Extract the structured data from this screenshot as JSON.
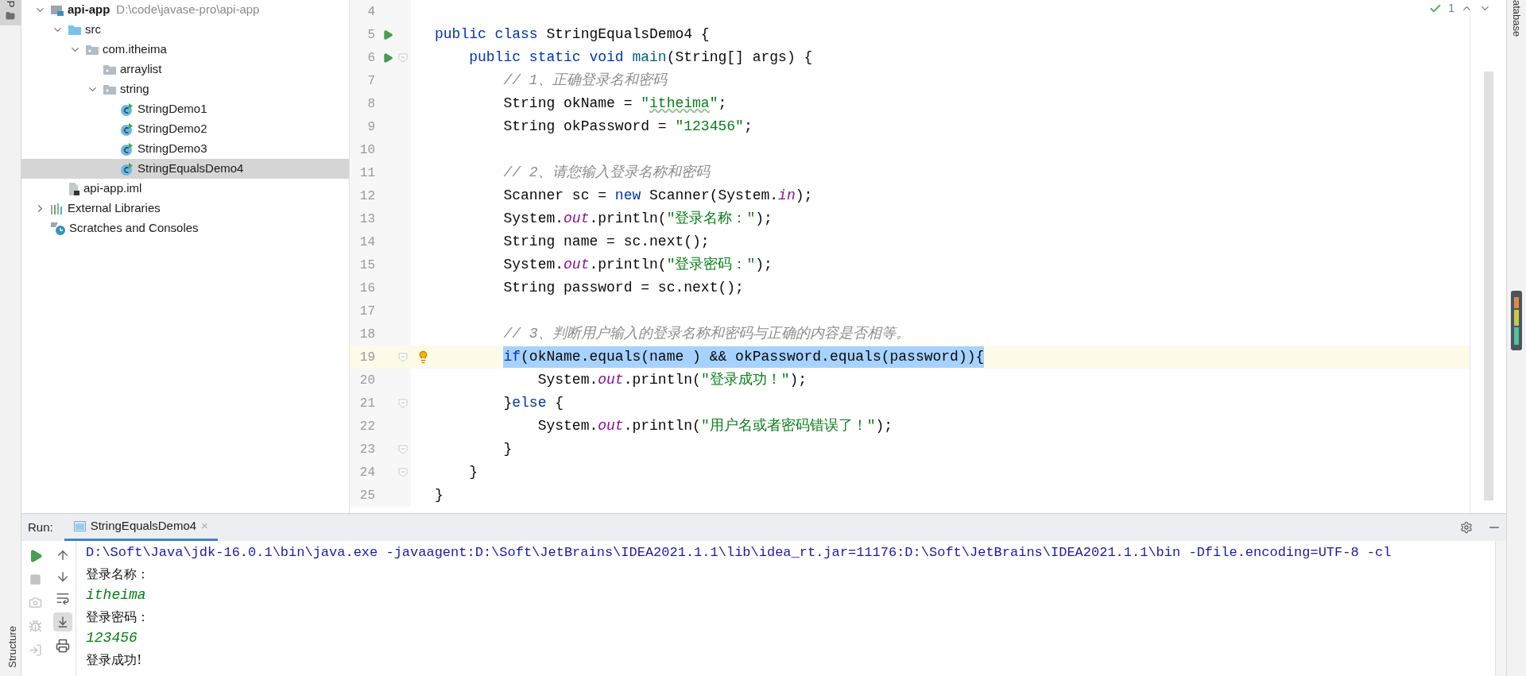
{
  "left_strip": {
    "top_tab": {
      "label": "P",
      "selected": true
    },
    "bottom_tab": {
      "label": "Structure"
    }
  },
  "right_strip": {
    "label": "atabase"
  },
  "project_tree": [
    {
      "label": "api-app",
      "path": "D:\\code\\javase-pro\\api-app",
      "kind": "module",
      "expanded": true,
      "selected": false,
      "children": [
        {
          "label": "src",
          "kind": "source_folder",
          "expanded": true,
          "selected": false,
          "children": [
            {
              "label": "com.itheima",
              "kind": "package",
              "expanded": true,
              "selected": false,
              "children": [
                {
                  "label": "arraylist",
                  "kind": "package",
                  "selected": false
                },
                {
                  "label": "string",
                  "kind": "package",
                  "expanded": true,
                  "selected": false,
                  "children": [
                    {
                      "label": "StringDemo1",
                      "kind": "class",
                      "selected": false
                    },
                    {
                      "label": "StringDemo2",
                      "kind": "class",
                      "selected": false
                    },
                    {
                      "label": "StringDemo3",
                      "kind": "class",
                      "selected": false
                    },
                    {
                      "label": "StringEqualsDemo4",
                      "kind": "class",
                      "selected": true
                    }
                  ]
                }
              ]
            }
          ]
        },
        {
          "label": "api-app.iml",
          "kind": "iml",
          "selected": false
        }
      ]
    },
    {
      "label": "External Libraries",
      "kind": "libraries",
      "expanded": false,
      "selected": false
    },
    {
      "label": "Scratches and Consoles",
      "kind": "scratches",
      "selected": false
    }
  ],
  "editor": {
    "inspections": {
      "count": "1"
    },
    "lines": [
      {
        "number": "4"
      },
      {
        "number": "5",
        "run": true,
        "tokens": [
          {
            "kind": "kw",
            "text": "public class"
          },
          {
            "kind": "id",
            "text": " StringEqualsDemo4 {"
          }
        ]
      },
      {
        "number": "6",
        "run": true,
        "fold": true,
        "tokens": [
          {
            "kind": "kw",
            "text": "    public static void "
          },
          {
            "kind": "fn",
            "text": "main"
          },
          {
            "kind": "id",
            "text": "(String[] args) {"
          }
        ]
      },
      {
        "number": "7",
        "tokens": [
          {
            "kind": "com",
            "text": "        // 1、正确登录名和密码"
          }
        ]
      },
      {
        "number": "8",
        "tokens": [
          {
            "kind": "id",
            "text": "        String okName = "
          },
          {
            "kind": "str",
            "text": "\""
          },
          {
            "kind": "str_warn",
            "text": "itheima"
          },
          {
            "kind": "str",
            "text": "\""
          },
          {
            "kind": "id",
            "text": ";"
          }
        ]
      },
      {
        "number": "9",
        "tokens": [
          {
            "kind": "id",
            "text": "        String okPassword = "
          },
          {
            "kind": "str",
            "text": "\"123456\""
          },
          {
            "kind": "id",
            "text": ";"
          }
        ]
      },
      {
        "number": "10"
      },
      {
        "number": "11",
        "tokens": [
          {
            "kind": "com",
            "text": "        // 2、请您输入登录名称和密码"
          }
        ]
      },
      {
        "number": "12",
        "tokens": [
          {
            "kind": "id",
            "text": "        Scanner sc = "
          },
          {
            "kind": "kw",
            "text": "new"
          },
          {
            "kind": "id",
            "text": " Scanner(System."
          },
          {
            "kind": "field",
            "text": "in"
          },
          {
            "kind": "id",
            "text": ");"
          }
        ]
      },
      {
        "number": "13",
        "tokens": [
          {
            "kind": "id",
            "text": "        System."
          },
          {
            "kind": "field",
            "text": "out"
          },
          {
            "kind": "id",
            "text": ".println("
          },
          {
            "kind": "str",
            "text": "\"登录名称：\""
          },
          {
            "kind": "id",
            "text": ");"
          }
        ]
      },
      {
        "number": "14",
        "tokens": [
          {
            "kind": "id",
            "text": "        String name = sc.next();"
          }
        ]
      },
      {
        "number": "15",
        "tokens": [
          {
            "kind": "id",
            "text": "        System."
          },
          {
            "kind": "field",
            "text": "out"
          },
          {
            "kind": "id",
            "text": ".println("
          },
          {
            "kind": "str",
            "text": "\"登录密码：\""
          },
          {
            "kind": "id",
            "text": ");"
          }
        ]
      },
      {
        "number": "16",
        "tokens": [
          {
            "kind": "id",
            "text": "        String password = sc.next();"
          }
        ]
      },
      {
        "number": "17"
      },
      {
        "number": "18",
        "tokens": [
          {
            "kind": "com",
            "text": "        // 3、判断用户输入的登录名称和密码与正确的内容是否相等。"
          }
        ]
      },
      {
        "number": "19",
        "current": true,
        "highlighted": true,
        "fold": true,
        "bulb": true,
        "tokens": [
          {
            "kind": "kw",
            "text": "        if"
          },
          {
            "kind": "id",
            "text": "(okName.equals(name ) && okPassword.equals(password)){"
          }
        ]
      },
      {
        "number": "20",
        "tokens": [
          {
            "kind": "id",
            "text": "            System."
          },
          {
            "kind": "field",
            "text": "out"
          },
          {
            "kind": "id",
            "text": ".println("
          },
          {
            "kind": "str",
            "text": "\"登录成功！\""
          },
          {
            "kind": "id",
            "text": ");"
          }
        ]
      },
      {
        "number": "21",
        "fold": true,
        "tokens": [
          {
            "kind": "id",
            "text": "        }"
          },
          {
            "kind": "kw",
            "text": "else"
          },
          {
            "kind": "id",
            "text": " {"
          }
        ]
      },
      {
        "number": "22",
        "tokens": [
          {
            "kind": "id",
            "text": "            System."
          },
          {
            "kind": "field",
            "text": "out"
          },
          {
            "kind": "id",
            "text": ".println("
          },
          {
            "kind": "str",
            "text": "\"用户名或者密码错误了！\""
          },
          {
            "kind": "id",
            "text": ");"
          }
        ]
      },
      {
        "number": "23",
        "fold": true,
        "tokens": [
          {
            "kind": "id",
            "text": "        }"
          }
        ]
      },
      {
        "number": "24",
        "fold": true,
        "tokens": [
          {
            "kind": "id",
            "text": "    }"
          }
        ]
      },
      {
        "number": "25",
        "tokens": [
          {
            "kind": "id",
            "text": "}"
          }
        ]
      }
    ]
  },
  "run_panel": {
    "label": "Run:",
    "tabs": [
      {
        "label": "StringEqualsDemo4",
        "selected": true,
        "close": "×"
      }
    ],
    "scroll_to_end": true,
    "console": [
      {
        "kind": "command",
        "text": "D:\\Soft\\Java\\jdk-16.0.1\\bin\\java.exe -javaagent:D:\\Soft\\JetBrains\\IDEA2021.1.1\\lib\\idea_rt.jar=11176:D:\\Soft\\JetBrains\\IDEA2021.1.1\\bin -Dfile.encoding=UTF-8 -cl"
      },
      {
        "kind": "output",
        "text": "登录名称："
      },
      {
        "kind": "input",
        "text": "itheima"
      },
      {
        "kind": "output",
        "text": "登录密码："
      },
      {
        "kind": "input",
        "text": "123456"
      },
      {
        "kind": "output",
        "text": "登录成功!"
      }
    ]
  }
}
